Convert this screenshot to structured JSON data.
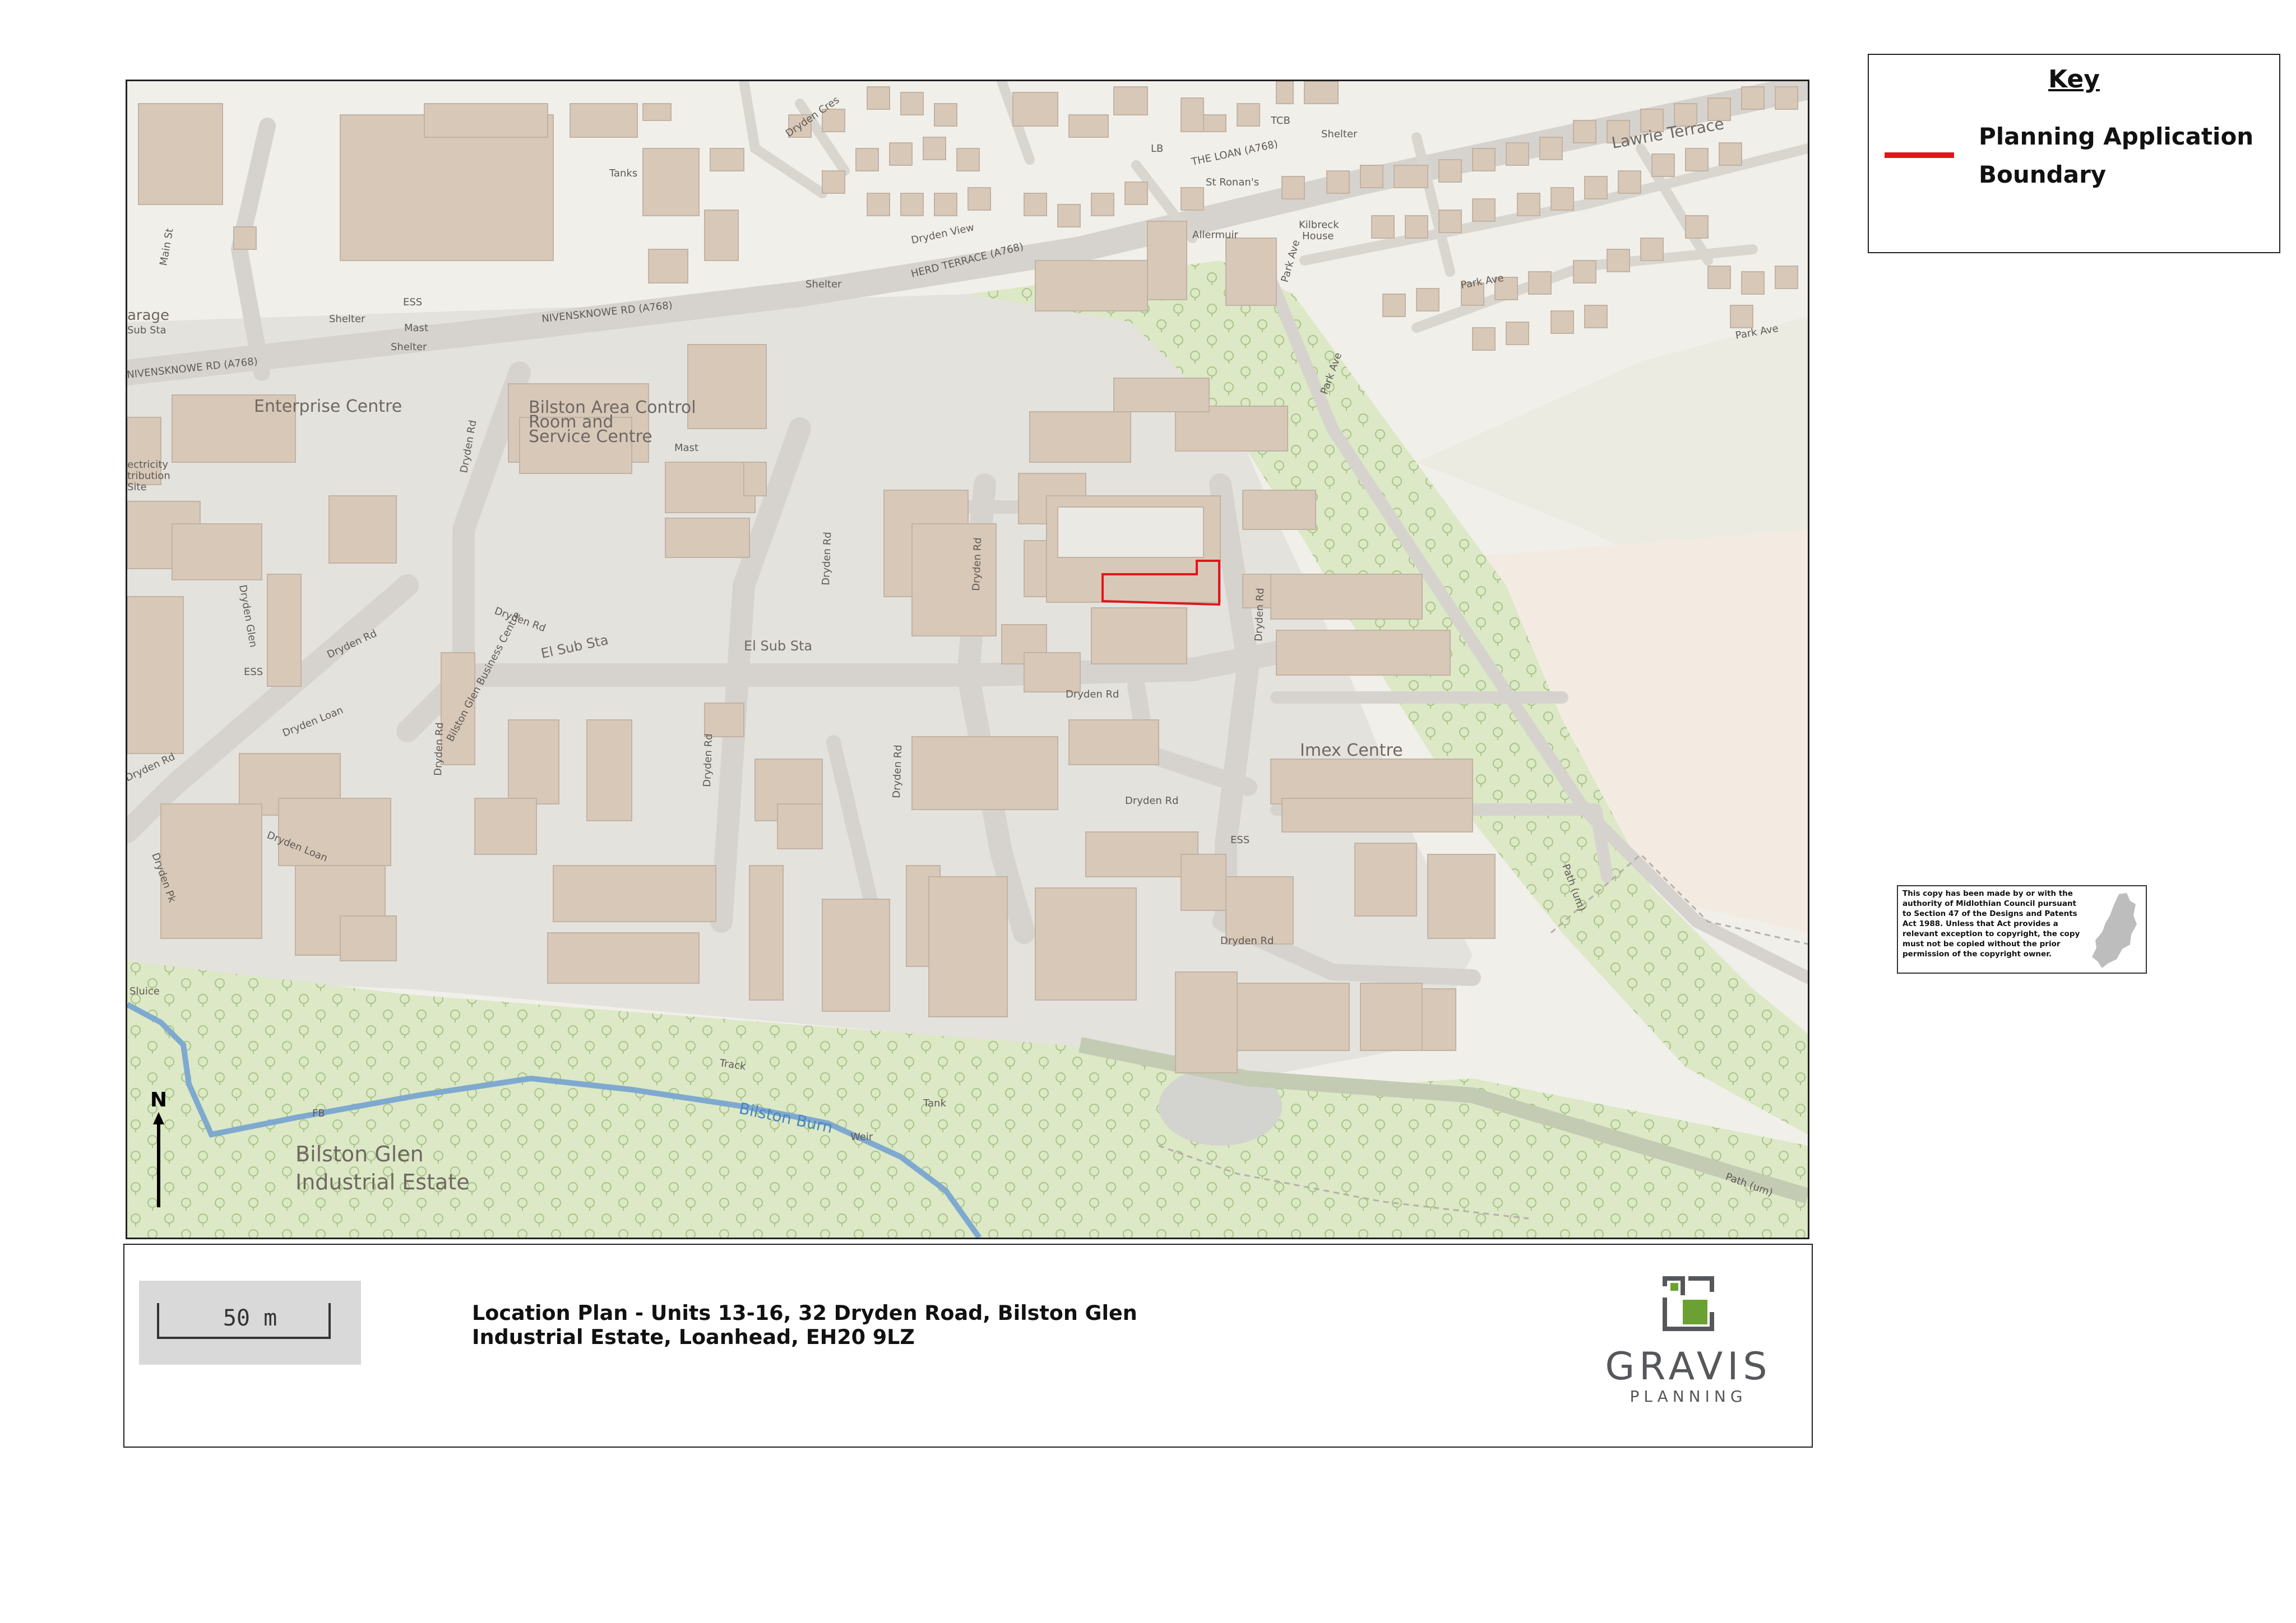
{
  "map": {
    "north_label": "N",
    "labels": {
      "main_st": "Main St",
      "tanks": "Tanks",
      "dryden_cres": "Dryden Cres",
      "dryden_view": "Dryden View",
      "herd_terrace": "HERD TERRACE (A768)",
      "the_loan": "THE LOAN (A768)",
      "shelter_1": "Shelter",
      "shelter_2": "Shelter",
      "shelter_3": "Shelter",
      "shelter_4": "Shelter",
      "ess_1": "ESS",
      "ess_2": "ESS",
      "ess_3": "ESS",
      "mast_1": "Mast",
      "mast_2": "Mast",
      "garage": "arage",
      "sub_sta": "Sub Sta",
      "nivensknowe": "NIVENSKNOWE RD (A768)",
      "enterprise": "Enterprise Centre",
      "bilston_area_1": "Bilston Area Control",
      "bilston_area_2": "Room and",
      "bilston_area_3": "Service Centre",
      "electricity_1": "ectricity",
      "electricity_2": "tribution",
      "electricity_3": "Site",
      "dryden_rd_1": "Dryden Rd",
      "dryden_rd_2": "Dryden Rd",
      "dryden_rd_3": "Dryden Rd",
      "dryden_rd_4": "Dryden Rd",
      "dryden_rd_5": "Dryden Rd",
      "dryden_rd_6": "Dryden Rd",
      "dryden_rd_7": "Dryden Rd",
      "dryden_rd_8": "Dryden Rd",
      "dryden_rd_9": "Dryden Rd",
      "dryden_rd_10": "Dryden Rd",
      "dryden_rd_11": "Dryden Rd",
      "dryden_rd_12": "Dryden Rd",
      "dryden_glen": "Dryden Glen",
      "dryden_loan_1": "Dryden Loan",
      "dryden_loan_2": "Dryden Loan",
      "dryden_pk": "Dryden Pk",
      "el_sub_sta_1": "El Sub Sta",
      "el_sub_sta_2": "El Sub Sta",
      "bilston_glen_bc": "Bilston Glen Business Centre",
      "imex": "Imex Centre",
      "lawrie": "Lawrie Terrace",
      "park_ave_1": "Park Ave",
      "park_ave_2": "Park Ave",
      "park_ave_3": "Park Ave",
      "park_ave_4": "Park Ave",
      "allermuir": "Allermuir",
      "st_ronans": "St Ronan's",
      "kilbreck_1": "Kilbreck",
      "kilbreck_2": "House",
      "lb": "LB",
      "tcb": "TCB",
      "path_1": "Path (um)",
      "path_2": "Path (um)",
      "sluice": "Sluice",
      "fb": "FB",
      "track": "Track",
      "tank": "Tank",
      "weir": "Weir",
      "bilston_burn": "Bilston Burn",
      "bilston_glen_1": "Bilston Glen",
      "bilston_glen_2": "Industrial Estate"
    }
  },
  "key": {
    "title": "Key",
    "items": [
      {
        "label": "Planning Application Boundary",
        "color": "#e0161b"
      }
    ]
  },
  "copyright": {
    "text": "This copy has been made by or with the authority of Midlothian Council pursuant to Section 47 of the Designs and Patents Act 1988. Unless that Act provides a relevant exception to copyright, the copy must not be copied without the prior permission of the copyright owner."
  },
  "title_block": {
    "scale": "50 m",
    "plan_title": "Location Plan - Units 13-16, 32 Dryden Road, Bilston Glen Industrial Estate, Loanhead, EH20 9LZ",
    "logo_word": "GRAVIS",
    "logo_sub": "PLANNING",
    "logo_colors": {
      "grey": "#55575a",
      "green": "#6aa132"
    }
  },
  "colors": {
    "building": "#d8c8b8",
    "road": "#dad8d4",
    "land": "#f1efe9",
    "green": "#dce8c6",
    "water": "#7fa9cf",
    "boundary": "#e0161b"
  }
}
